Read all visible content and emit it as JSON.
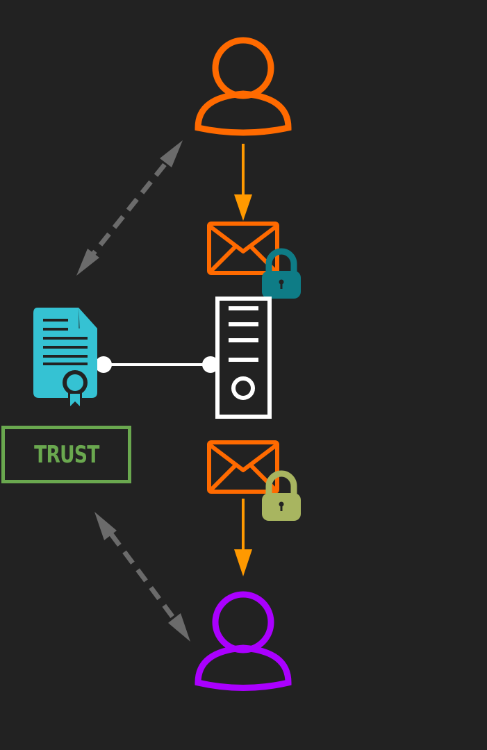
{
  "diagram": {
    "trust_label": "TRUST",
    "icons": {
      "sender": "user-icon",
      "recipient": "user-icon",
      "message_top": "envelope-icon",
      "message_bottom": "envelope-icon",
      "lock_top": "lock-icon",
      "lock_bottom": "lock-icon",
      "server": "server-icon",
      "certificate": "certificate-icon"
    },
    "colors": {
      "background": "#222222",
      "sender": "#ff6a00",
      "recipient": "#aa00ff",
      "envelope": "#ff6a00",
      "flow_arrow": "#ff9900",
      "lock_top": "#0e7c86",
      "lock_bottom": "#a8b560",
      "server": "#ffffff",
      "certificate": "#35c2d3",
      "trust": "#6aa84f",
      "dashed_arrow": "#6b6b6b"
    }
  }
}
